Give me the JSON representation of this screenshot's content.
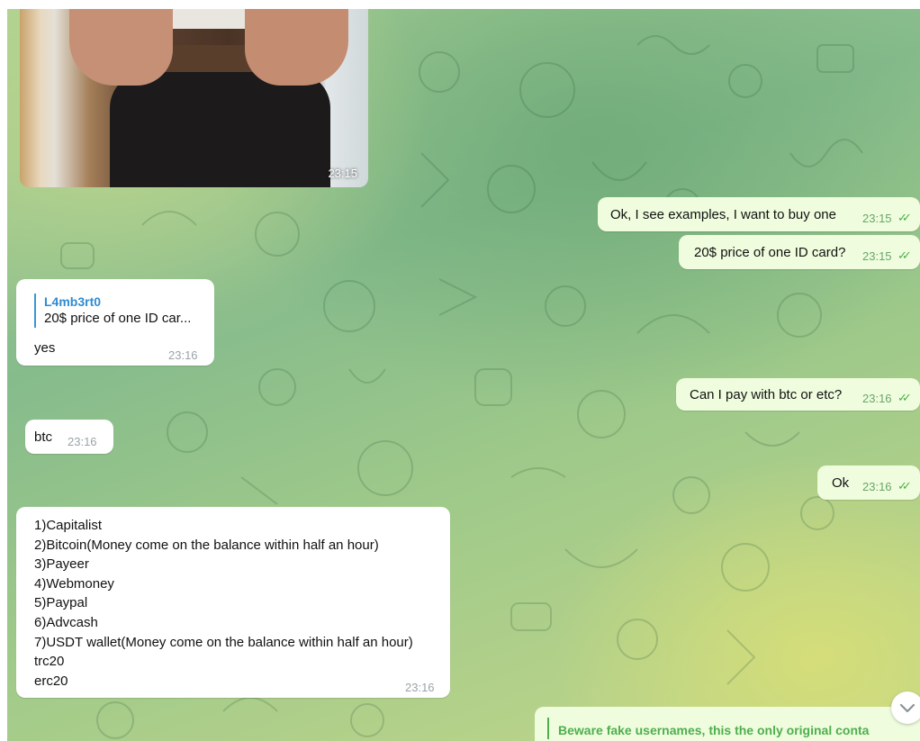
{
  "messages": {
    "photo_time": "23:15",
    "out1": {
      "text": "Ok, I see examples, I want to buy one",
      "time": "23:15"
    },
    "out2": {
      "text": "20$ price of one ID card?",
      "time": "23:15"
    },
    "in1": {
      "reply_name": "L4mb3rt0",
      "reply_text": "20$ price of one ID car...",
      "text": "yes",
      "time": "23:16"
    },
    "out3": {
      "text": "Can I pay with btc or etc?",
      "time": "23:16"
    },
    "in2": {
      "text": "btc",
      "time": "23:16"
    },
    "out4": {
      "text": "Ok",
      "time": "23:16"
    },
    "in3": {
      "lines": [
        "1)Capitalist",
        "2)Bitcoin(Money come on the balance within half an hour)",
        "3)Payeer",
        "4)Webmoney",
        "5)Paypal",
        "6)Advcash",
        "7)USDT wallet(Money come on the balance within half an hour)",
        "trc20",
        "erc20"
      ],
      "time": "23:16"
    }
  },
  "pinned": {
    "text": "Beware fake usernames, this the only original conta"
  },
  "icons": {
    "check": "double-check-icon",
    "scroll": "chevron-down-icon"
  },
  "colors": {
    "outgoing_bubble": "#effdde",
    "incoming_bubble": "#ffffff",
    "reply_accent": "#3a95d5",
    "check": "#4fae4e"
  }
}
